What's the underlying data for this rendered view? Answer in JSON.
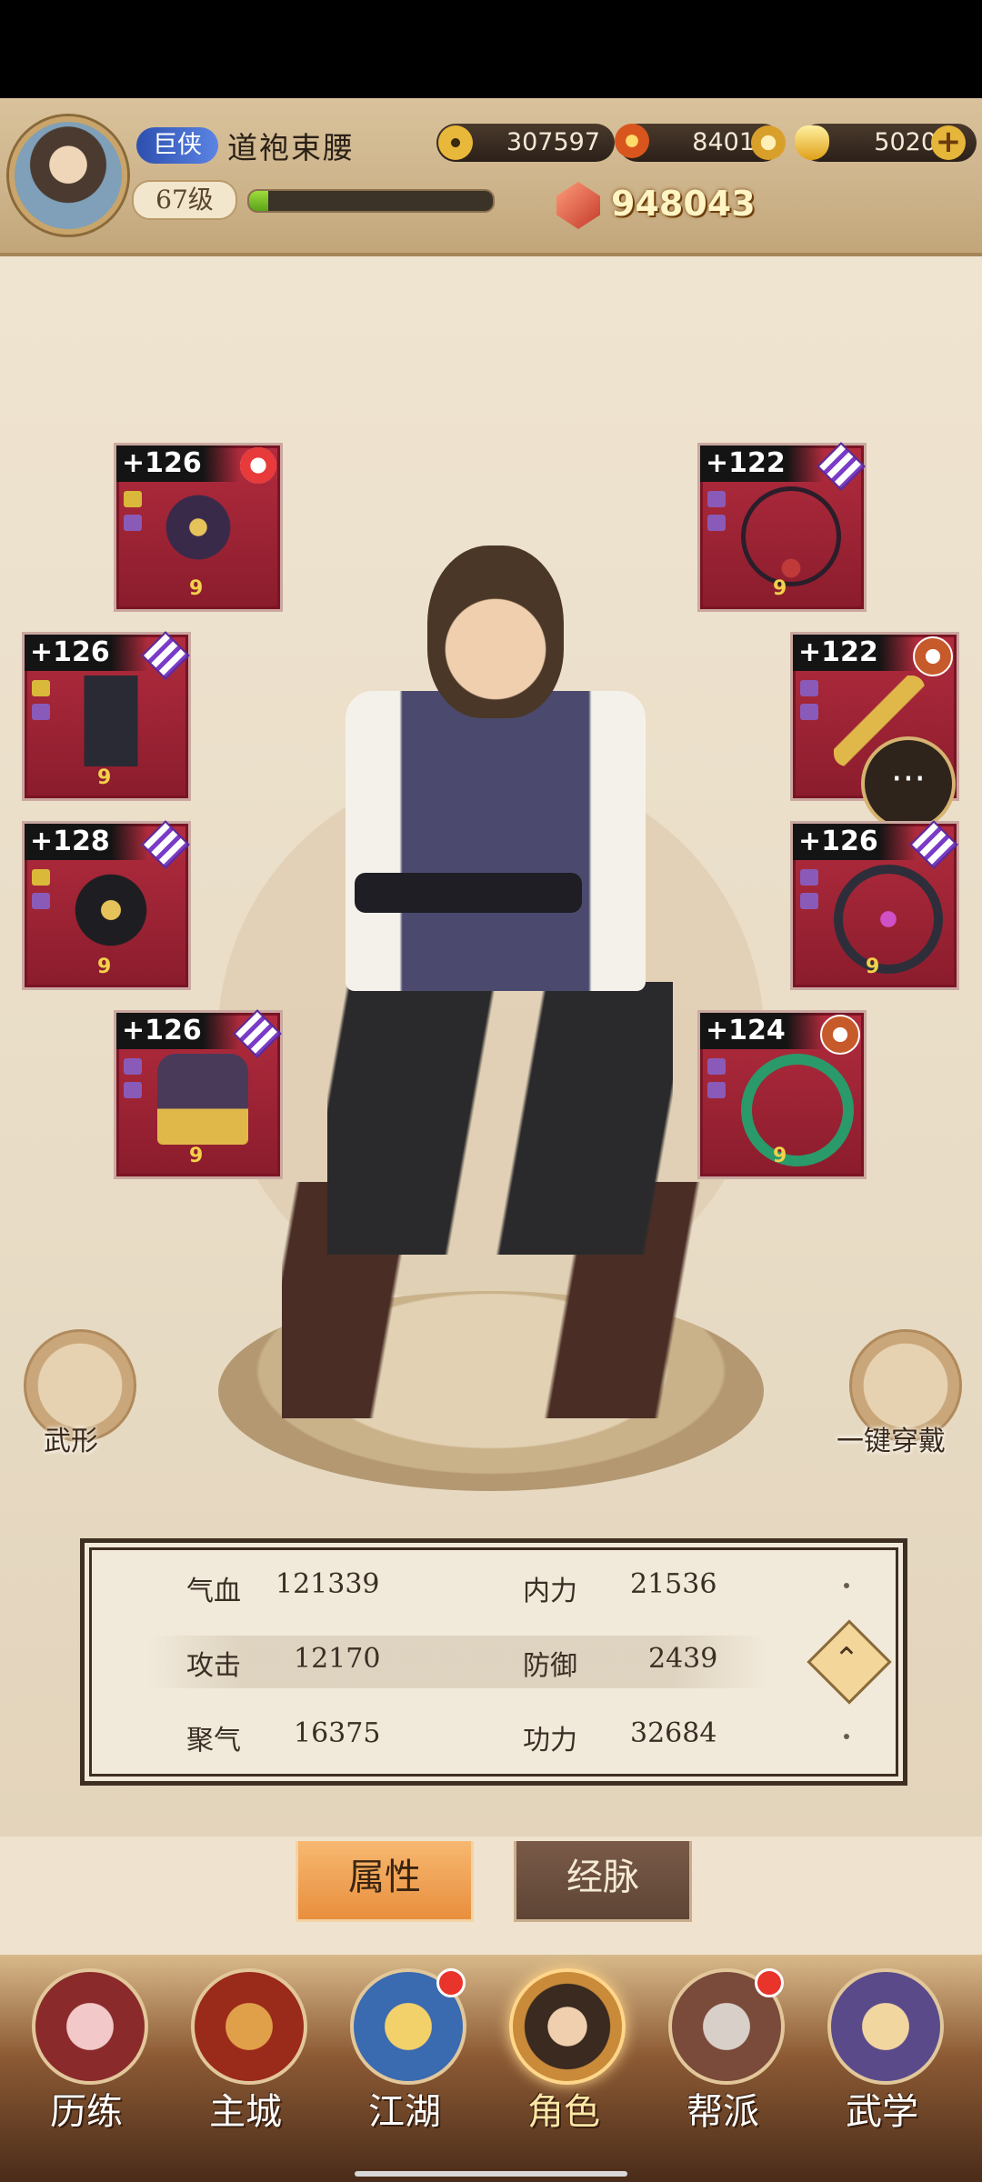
{
  "header": {
    "rank": "巨侠",
    "player_name": "道袍束腰",
    "level": "67级",
    "xp_fraction": 0.08,
    "currencies": [
      {
        "icon": "copper-coin-icon",
        "value": "307597"
      },
      {
        "icon": "flame-crystal-icon",
        "value": "8401"
      },
      {
        "icon": "gold-ingot-icon",
        "value": "5020"
      }
    ],
    "power": "948043"
  },
  "equipment": {
    "left": [
      {
        "level": "+126",
        "item": "whip-weapon-icon",
        "badge": "red-orb-badge"
      },
      {
        "level": "+126",
        "item": "robe-armor-icon",
        "badge": "purple-diamond-badge"
      },
      {
        "level": "+128",
        "item": "belt-icon",
        "badge": "purple-diamond-badge"
      },
      {
        "level": "+126",
        "item": "boots-icon",
        "badge": "purple-diamond-badge"
      }
    ],
    "right": [
      {
        "level": "+122",
        "item": "necklace-icon",
        "badge": "purple-diamond-badge"
      },
      {
        "level": "+122",
        "item": "hairpin-icon",
        "badge": "orange-star-badge"
      },
      {
        "level": "+126",
        "item": "bracer-icon",
        "badge": "purple-diamond-badge"
      },
      {
        "level": "+124",
        "item": "jade-ring-icon",
        "badge": "orange-star-badge"
      }
    ]
  },
  "side_buttons": {
    "left_label": "武形",
    "right_label": "一键穿戴"
  },
  "stats": [
    {
      "label": "气血",
      "value": "121339"
    },
    {
      "label": "内力",
      "value": "21536"
    },
    {
      "label": "攻击",
      "value": "12170"
    },
    {
      "label": "防御",
      "value": "2439"
    },
    {
      "label": "聚气",
      "value": "16375"
    },
    {
      "label": "功力",
      "value": "32684"
    }
  ],
  "tabs": {
    "attributes": "属性",
    "meridians": "经脉"
  },
  "nav": [
    {
      "label": "历练",
      "badge": false
    },
    {
      "label": "主城",
      "badge": false
    },
    {
      "label": "江湖",
      "badge": true
    },
    {
      "label": "角色",
      "badge": false,
      "active": true
    },
    {
      "label": "帮派",
      "badge": true
    },
    {
      "label": "武学",
      "badge": false
    }
  ],
  "colors": {
    "slot_bg": "#9a2434",
    "accent_tab": "#e88f3d",
    "badge_red": "#e8342a"
  }
}
